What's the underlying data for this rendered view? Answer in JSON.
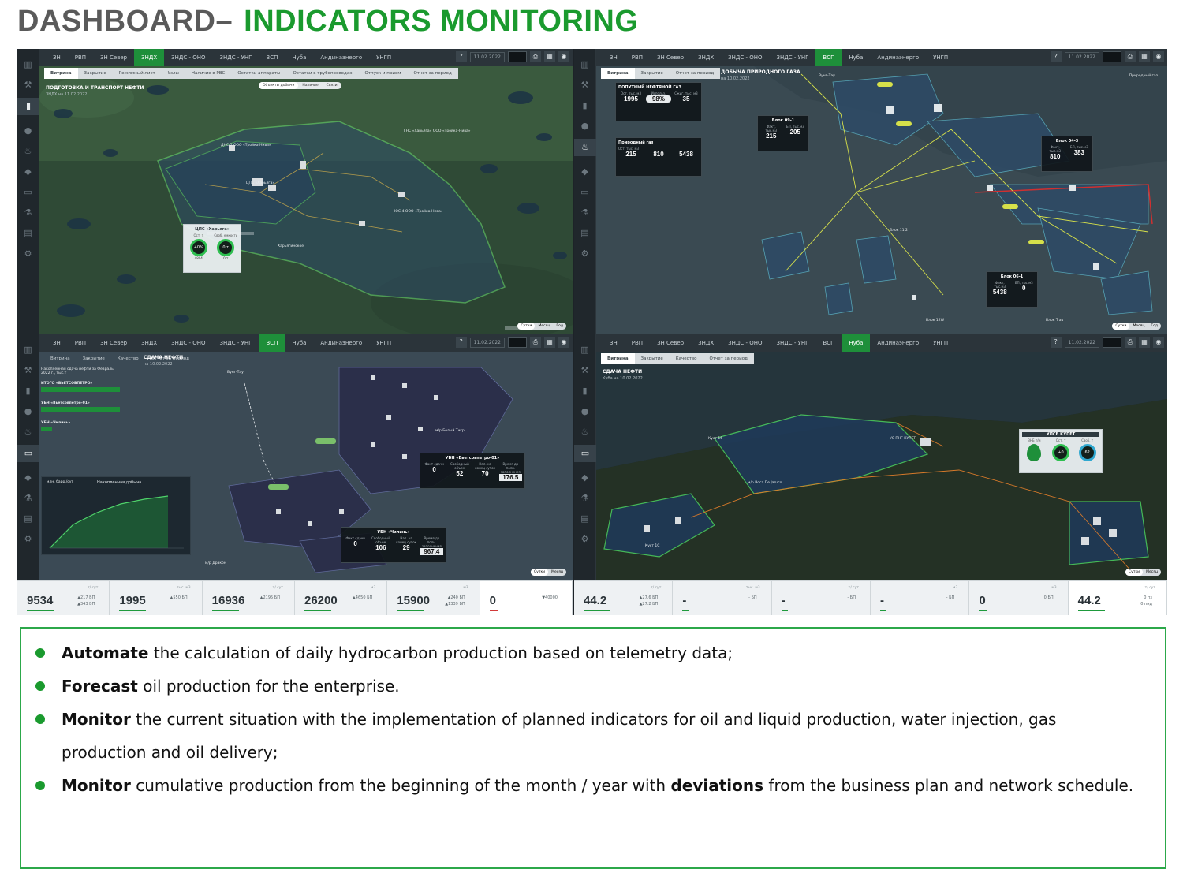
{
  "header": {
    "title_part1": "DASHBOARD–",
    "title_part2": "INDICATORS MONITORING"
  },
  "panels": {
    "p1": {
      "tabs": [
        "ЗН",
        "РВП",
        "ЗН Север",
        "ЗНДХ",
        "ЗНДС - ОНО",
        "ЗНДС - УНГ",
        "ВСП",
        "Нуба",
        "Андинаэнерго",
        "УНГП"
      ],
      "active_tab": "ЗНДХ",
      "subtabs": [
        "Витрина",
        "Закрытие",
        "Режимный лист",
        "Узлы",
        "Наличие в РВС",
        "Остатки аппараты",
        "Остатки в трубопроводах",
        "Отпуск и прием",
        "Отчет за период"
      ],
      "date": "11.02.2022",
      "map_title": "ПОДГОТОВКА И ТРАНСПОРТ НЕФТИ",
      "map_date": "ЗНДХ на 11.02.2022",
      "toggle": [
        "Объекты добычи",
        "Наличие",
        "Связи"
      ],
      "labels": [
        "ДНС-2 ООО «Тройка-Нива»",
        "ЦПС «Харьяга»",
        "ГНС «Харьяга» ООО «Тройка-Нива»",
        "ЮС-4 ООО «Тройка-Нива»",
        "Харьягинское"
      ],
      "card": {
        "title": "ЦПС «Харьяга»",
        "c1_label": "Ост. т",
        "c2_label": "Своб. емкость",
        "c1_ring": "+0%",
        "c2_ring": "0 т",
        "c1_val": "4804",
        "c2_val": "0 т"
      },
      "toggle_bottom": [
        "Сутки",
        "Месяц",
        "Год"
      ]
    },
    "p2": {
      "tabs": [
        "ЗН",
        "РВП",
        "ЗН Север",
        "ЗНДХ",
        "ЗНДС - ОНО",
        "ЗНДС - УНГ",
        "ВСП",
        "Нуба",
        "Андинаэнерго",
        "УНГП"
      ],
      "active_tab": "ВСП",
      "subtabs": [
        "Витрина",
        "Закрытие",
        "Отчет за период"
      ],
      "date": "11.02.2022",
      "map_title": "ДОБЫЧА ПРИРОДНОГО ГАЗА",
      "map_date": "на 10.02.2022",
      "legend": "Природный газ",
      "card_apg": {
        "title": "ПОПУТНЫЙ НЕФТЯНОЙ ГАЗ",
        "l1": "Ост. тыс. м3",
        "l2": "Использ.",
        "l3": "Сжиг. тыс. м3",
        "v1": "1995",
        "v2": "98%",
        "v3": "35"
      },
      "card_ng": {
        "title": "Природный газ",
        "l1": "Ост. тыс. м3",
        "v1": "215",
        "v2": "810",
        "v3": "5438"
      },
      "blocks": [
        {
          "name": "Блок 09-1",
          "l1": "Факт, тыс.м3",
          "l2": "БП, тыс.м3",
          "v1": "215",
          "v2": "205"
        },
        {
          "name": "Блок 04-3",
          "l1": "Факт, тыс.м3",
          "l2": "БП, тыс.м3",
          "v1": "810",
          "v2": "383"
        },
        {
          "name": "Блок 06-1",
          "l1": "Факт, тыс.м3",
          "l2": "БП, тыс.м3",
          "v1": "5438",
          "v2": "0"
        }
      ],
      "labels": [
        "Вунг-Тау",
        "Блок 09-1",
        "Блок 04-3",
        "Блок 11.2",
        "Блок 06-1",
        "Блок 12W",
        "Блок Trau"
      ],
      "toggle_bottom": [
        "Сутки",
        "Месяц",
        "Год"
      ]
    },
    "p3": {
      "tabs": [
        "ЗН",
        "РВП",
        "ЗН Север",
        "ЗНДХ",
        "ЗНДС - ОНО",
        "ЗНДС - УНГ",
        "ВСП",
        "Нуба",
        "Андинаэнерго",
        "УНГП"
      ],
      "active_tab": "ВСП",
      "subtabs": [
        "Витрина",
        "Закрытие",
        "Качество",
        "Отчет за период"
      ],
      "date": "11.02.2022",
      "map_title": "СДАЧА НЕФТИ",
      "map_date": "на 10.02.2022",
      "list_title": "Накопленная сдача нефти за Февраль 2022 г., тыс.т",
      "list": [
        {
          "name": "ИТОГО «ВЬЕТСОВПЕТРО»",
          "v": "1995"
        },
        {
          "name": "УБН «Вьетсовпетро-01»",
          "v": "1995"
        },
        {
          "name": "УБН «Чилинь»",
          "v": "0"
        }
      ],
      "chart_title": "Накопленная добыча",
      "chart_ylabel": "млн. барр./сут",
      "card1": {
        "title": "УБН «Вьетсовпетро-01»",
        "l1": "Факт сдачи",
        "l2": "Свободный объем",
        "l3": "Нал. на конец суток",
        "l4": "Время до полн. заполнения",
        "v1": "0",
        "v2": "52",
        "v3": "70",
        "v4": "176.5"
      },
      "card2": {
        "title": "УБН «Чилинь»",
        "l1": "Факт сдачи",
        "l2": "Свободный объем",
        "l3": "Нал. на конец суток",
        "l4": "Время до полн. заполнения",
        "v1": "0",
        "v2": "106",
        "v3": "29",
        "v4": "967.4"
      },
      "labels": [
        "Вунг-Тау",
        "м/р Белый Тигр",
        "м/р Дракон"
      ],
      "toggle_bottom": [
        "Сутки",
        "Месяц"
      ]
    },
    "p4": {
      "tabs": [
        "ЗН",
        "РВП",
        "ЗН Север",
        "ЗНДХ",
        "ЗНДС - ОНО",
        "ЗНДС - УНГ",
        "ВСП",
        "Нуба",
        "Андинаэнерго",
        "УНГП"
      ],
      "active_tab": "Нуба",
      "subtabs": [
        "Витрина",
        "Закрытие",
        "Качество",
        "Отчет за период"
      ],
      "date": "11.02.2022",
      "map_title": "СДАЧА НЕФТИ",
      "map_date": "Куба на 10.02.2022",
      "card": {
        "title": "УПСВ КУПЕТ",
        "l1": "ВНБ т/м",
        "l2": "Ост. т",
        "l3": "Своб. т",
        "r1": "+0",
        "r2": "62"
      },
      "labels": [
        "Куст 16",
        "м/р Boca De Jaruco",
        "УС ПНГ КУПЕТ",
        "Куст 1С"
      ],
      "toggle_bottom": [
        "Сутки",
        "Месяц"
      ]
    }
  },
  "bottom_left": [
    {
      "value": "9534",
      "head": "т/ сут",
      "s1": "▲217 БП",
      "s2": "▲343 БП"
    },
    {
      "value": "1995",
      "head": "тыс. м3",
      "s1": "▲550 БП",
      "s2": ""
    },
    {
      "value": "16936",
      "head": "т/ сут",
      "s1": "▲2195 БП",
      "s2": ""
    },
    {
      "value": "26200",
      "head": "м3",
      "s1": "▲4650 БП",
      "s2": ""
    },
    {
      "value": "15900",
      "head": "м3",
      "s1": "▲240 БП",
      "s2": "▲1339 БП"
    },
    {
      "value": "0",
      "head": "",
      "s1": "▼40000",
      "s2": ""
    }
  ],
  "bottom_right": [
    {
      "value": "44.2",
      "head": "т/ сут",
      "s1": "▲27.6 БП",
      "s2": "▲27.2 БП"
    },
    {
      "value": "-",
      "head": "тыс. м3",
      "s1": "- БП",
      "s2": ""
    },
    {
      "value": "-",
      "head": "т/ сут",
      "s1": "- БП",
      "s2": ""
    },
    {
      "value": "-",
      "head": "м3",
      "s1": "- БП",
      "s2": ""
    },
    {
      "value": "0",
      "head": "м3",
      "s1": "0 БП",
      "s2": ""
    },
    {
      "value": "44.2",
      "head": "т/ сут",
      "s1": "0 пз",
      "s2": "0 пнд"
    }
  ],
  "bullets": [
    {
      "bold": "Automate",
      "text": " the calculation of daily hydrocarbon production based on telemetry data;"
    },
    {
      "bold": "Forecast",
      "text": " oil production for the enterprise."
    },
    {
      "bold": "Monitor",
      "text": " the current situation with the implementation of planned indicators for oil and liquid production, water injection, gas production and oil delivery;"
    },
    {
      "bold": "Monitor",
      "text": " cumulative production from the beginning of the month / year with ",
      "bold2": "deviations",
      "text2": " from the business plan and network schedule."
    }
  ],
  "colors": {
    "brand_green": "#1a9a2e",
    "title_gray": "#5a5a5a"
  }
}
